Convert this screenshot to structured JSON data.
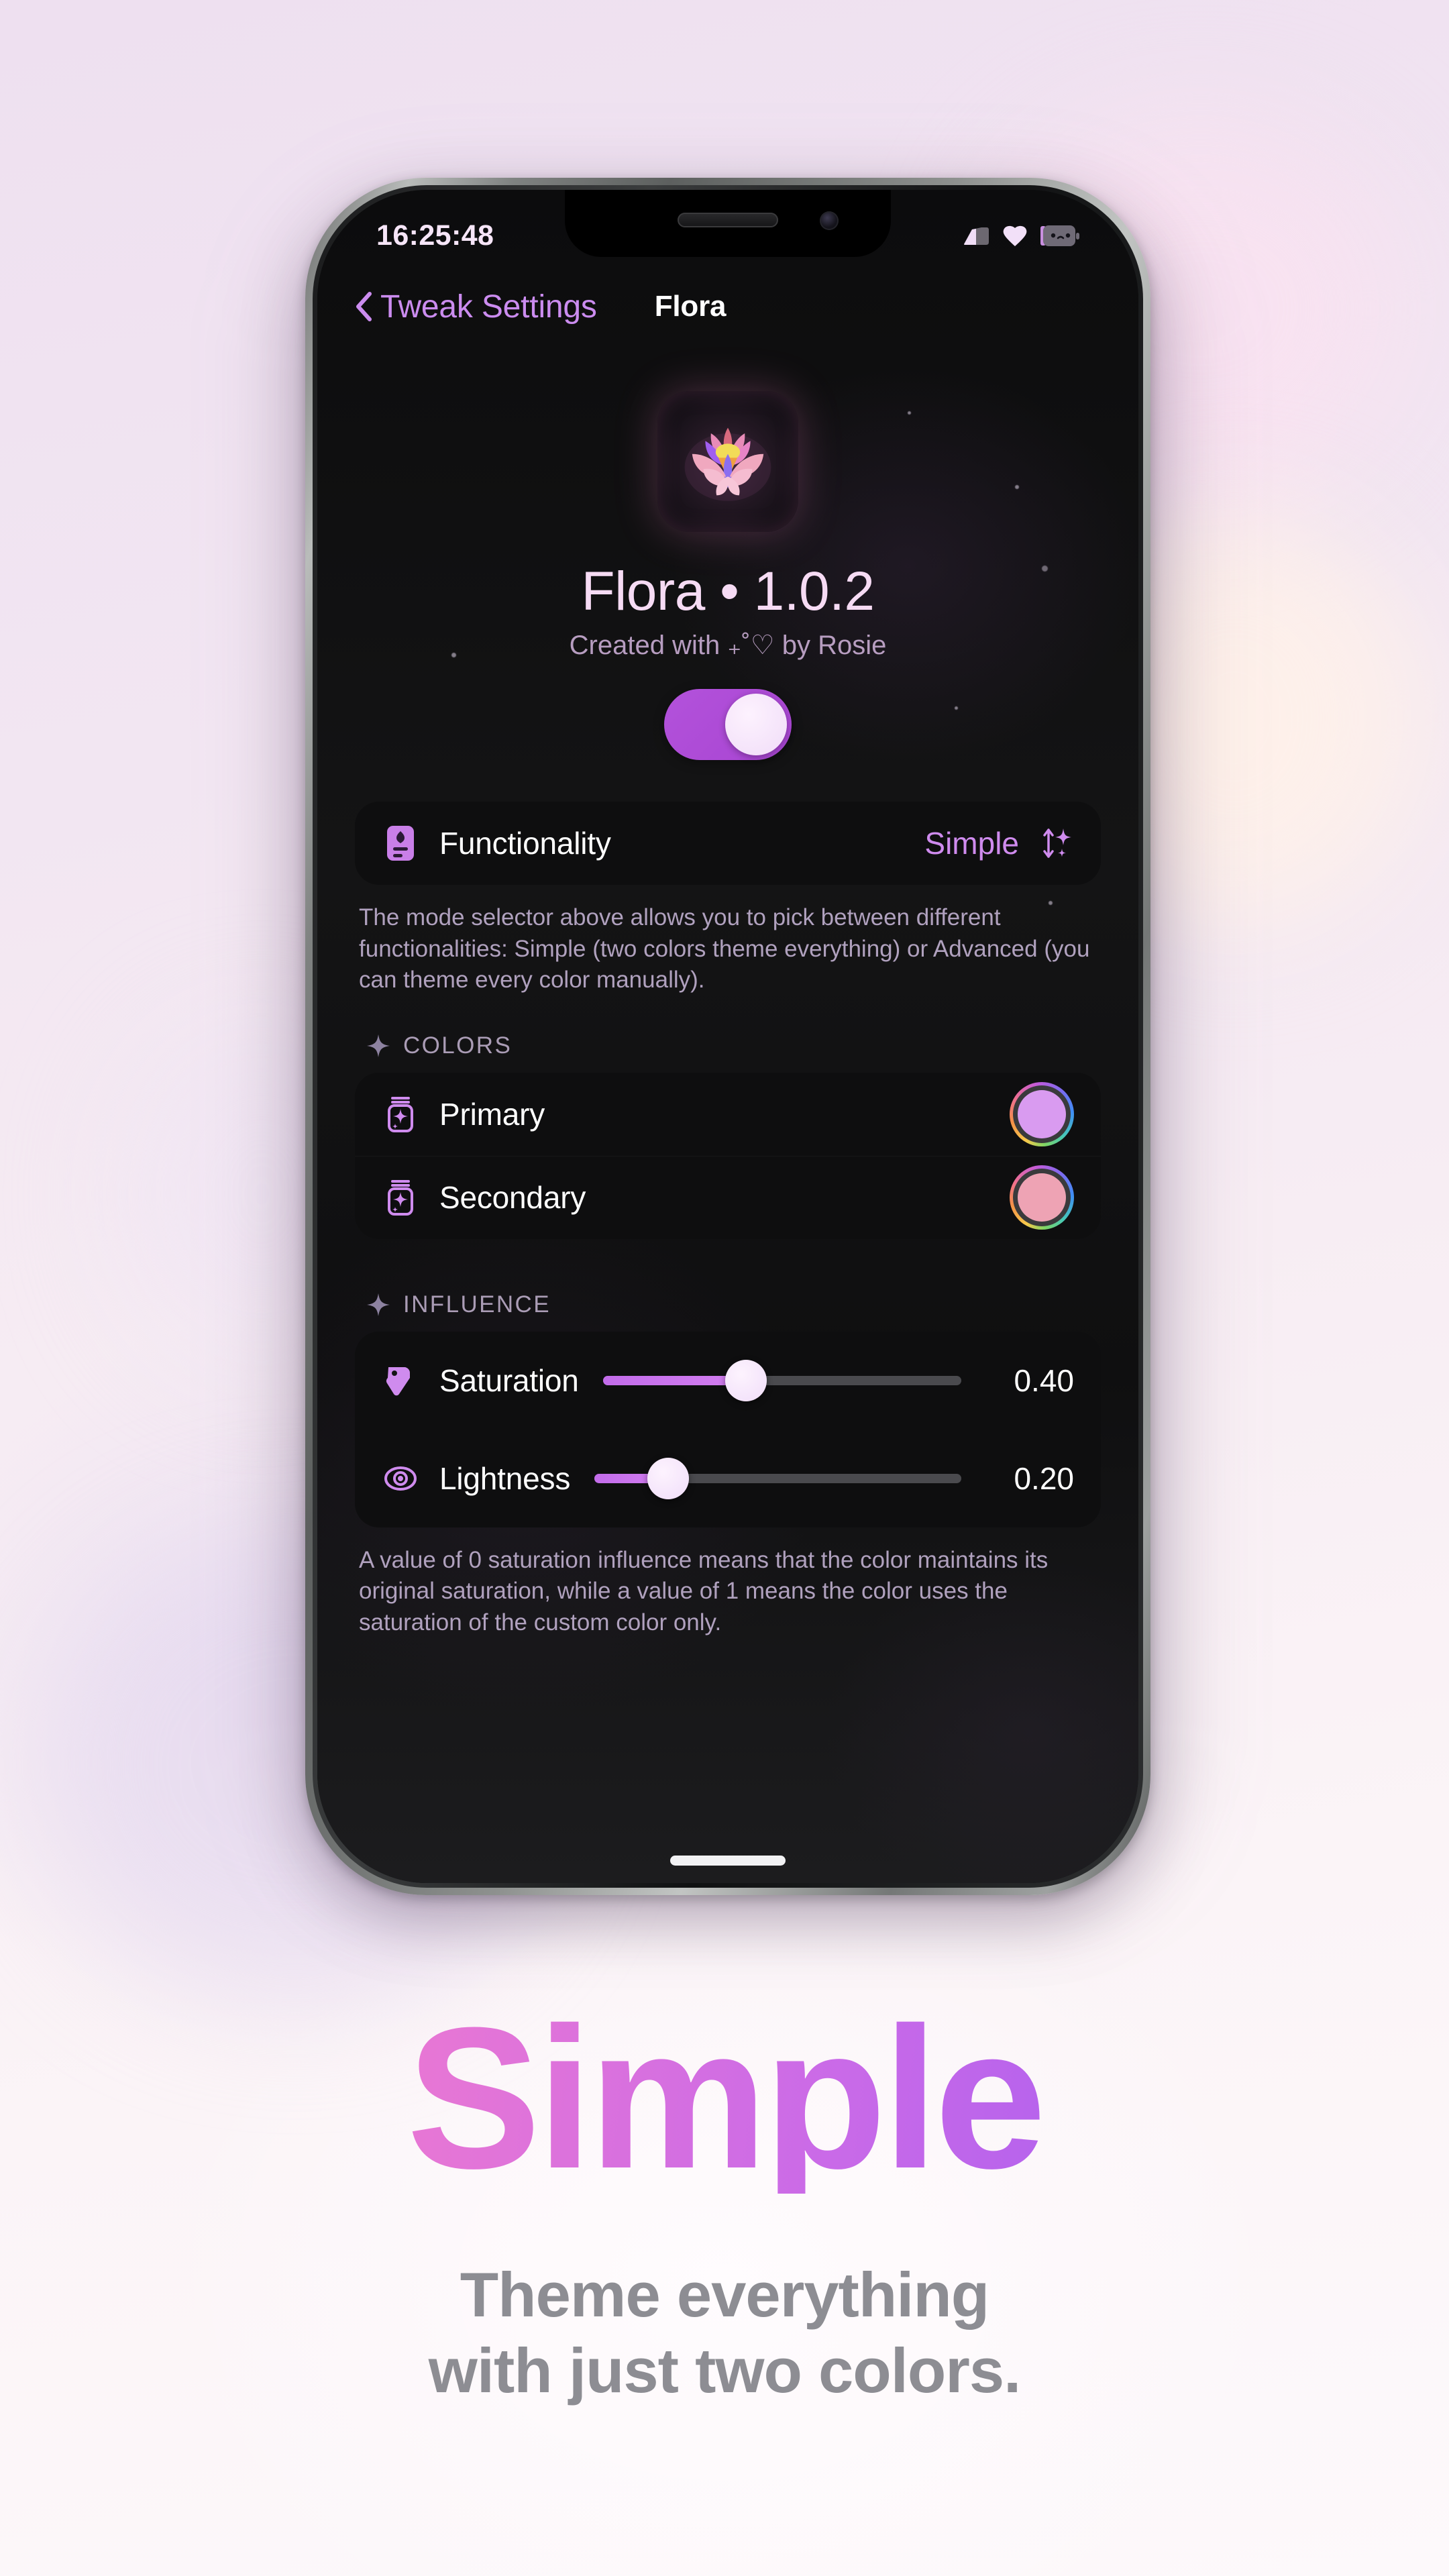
{
  "marketing": {
    "headline": "Simple",
    "subtitle_line1": "Theme everything",
    "subtitle_line2": "with just two colors.",
    "headline_gradient_start": "#F07FCB",
    "headline_gradient_end": "#9F59F2",
    "subtitle_color": "#8D8D93",
    "page_background": "#F2E6F2"
  },
  "status_bar": {
    "time": "16:25:48",
    "time_color": "#F6E5F8",
    "signal_icon": "cellular-signal-icon",
    "wifi_icon": "wifi-icon",
    "battery_icon": "battery-icon"
  },
  "nav": {
    "back_icon": "chevron-left-icon",
    "back_label": "Tweak Settings",
    "back_color": "#CB8CEF",
    "title": "Flora"
  },
  "hero": {
    "app_icon": "lotus-flower-icon",
    "title": "Flora • 1.0.2",
    "title_color": "#F6DBF4",
    "credit": "Created with ₊˚♡ by Rosie",
    "credit_color": "#B79DC0",
    "master_toggle": {
      "label": "master-enable-toggle",
      "state": "on",
      "track_color": "#AE4FD4",
      "knob_color": "#F0DCF8"
    }
  },
  "functionality": {
    "icon": "mode-card-icon",
    "label": "Functionality",
    "value": "Simple",
    "value_color": "#CF8BEE",
    "picker_icon": "up-down-sparkle-icon",
    "footnote": "The mode selector above allows you to pick between different functionalities: Simple (two colors theme everything) or Advanced (you can theme every color manually)."
  },
  "colors_section": {
    "header_icon": "sparkle-icon",
    "header": "COLORS",
    "rows": [
      {
        "icon": "color-jar-icon",
        "label": "Primary",
        "swatch_color": "#D99BF0"
      },
      {
        "icon": "color-jar-icon",
        "label": "Secondary",
        "swatch_color": "#EEA3B4"
      }
    ]
  },
  "influence_section": {
    "header_icon": "sparkle-icon",
    "header": "INFLUENCE",
    "rows": [
      {
        "icon": "tag-icon",
        "label": "Saturation",
        "value": "0.40",
        "percent": 40
      },
      {
        "icon": "eye-icon",
        "label": "Lightness",
        "value": "0.20",
        "percent": 20
      }
    ],
    "footnote": "A value of 0 saturation influence means that the color maintains its original saturation, while a value of 1 means the color uses the saturation of the custom color only."
  }
}
